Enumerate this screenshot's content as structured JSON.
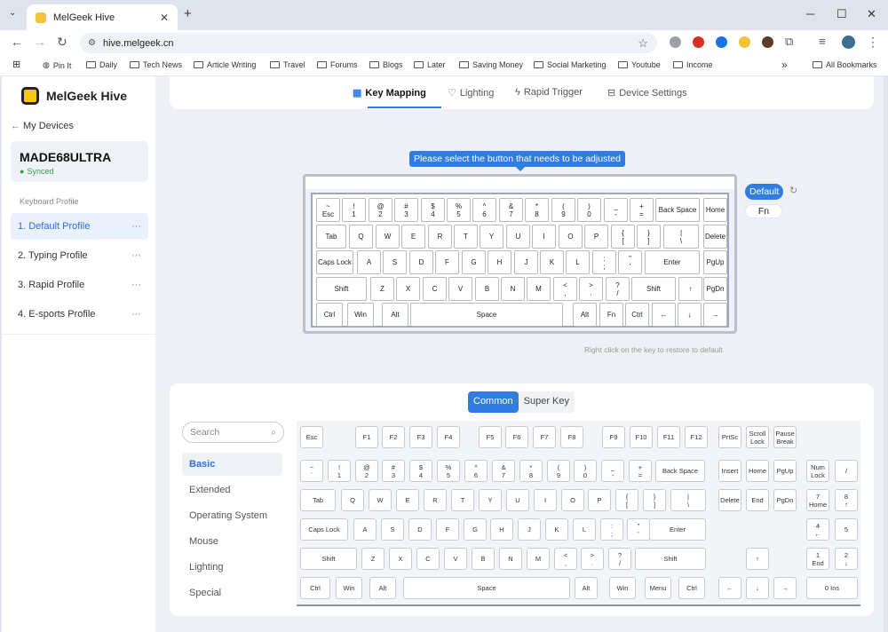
{
  "browser": {
    "tab_title": "MelGeek Hive",
    "url": "hive.melgeek.cn",
    "new_tab": "+",
    "tab_close": "✕",
    "win_min": "─",
    "win_max": "☐",
    "win_close": "✕",
    "bookmarks": [
      "Pin It",
      "Daily",
      "Tech News",
      "Article Writing",
      "Travel",
      "Forums",
      "Blogs",
      "Later",
      "Saving Money",
      "Social Marketing",
      "Youtube",
      "Income"
    ],
    "more_bookmarks": "»",
    "all_bookmarks": "All Bookmarks"
  },
  "sidebar": {
    "brand": "MelGeek Hive",
    "back_label": "My Devices",
    "device_name": "MADE68ULTRA",
    "device_status": "Synced",
    "section_label": "Keyboard Profile",
    "profiles": [
      {
        "label": "1. Default Profile",
        "active": true
      },
      {
        "label": "2. Typing Profile",
        "active": false
      },
      {
        "label": "3. Rapid Profile",
        "active": false
      },
      {
        "label": "4. E-sports Profile",
        "active": false
      }
    ],
    "more": "···"
  },
  "tabs": {
    "key_mapping": "Key Mapping",
    "lighting": "Lighting",
    "rapid_trigger": "Rapid Trigger",
    "device_settings": "Device Settings"
  },
  "mapping": {
    "tooltip": "Please select the button that needs to be adjusted",
    "layer_default": "Default",
    "layer_fn": "Fn",
    "hint": "Right click on the key to restore to default"
  },
  "keyboard_keys": [
    "~\nEsc",
    "!\n1",
    "@\n2",
    "#\n3",
    "$\n4",
    "%\n5",
    "^\n6",
    "&\n7",
    "*\n8",
    "(\n9",
    ")\n0",
    "_\n-",
    "+\n=",
    "Back Space",
    "Home",
    "Tab",
    "Q",
    "W",
    "E",
    "R",
    "T",
    "Y",
    "U",
    "I",
    "O",
    "P",
    "{\n[",
    "}\n]",
    "|\n\\",
    "Delete",
    "Caps Lock",
    "A",
    "S",
    "D",
    "F",
    "G",
    "H",
    "J",
    "K",
    "L",
    ":\n;",
    "\"\n'",
    "Enter",
    "PgUp",
    "Shift",
    "Z",
    "X",
    "C",
    "V",
    "B",
    "N",
    "M",
    "<\n,",
    ">\n.",
    "?\n/",
    "Shift",
    "↑",
    "PgDn",
    "Ctrl",
    "Win",
    "Alt",
    "Space",
    "Alt",
    "Fn",
    "Ctrl",
    "←",
    "↓",
    "→"
  ],
  "palette": {
    "seg_common": "Common",
    "seg_super": "Super Key",
    "search_placeholder": "Search",
    "categories": [
      "Basic",
      "Extended",
      "Operating System",
      "Mouse",
      "Lighting",
      "Special"
    ],
    "keys": [
      "Esc",
      "F1",
      "F2",
      "F3",
      "F4",
      "F5",
      "F6",
      "F7",
      "F8",
      "F9",
      "F10",
      "F11",
      "F12",
      "PrtSc",
      "Scroll\nLock",
      "Pause\nBreak",
      "~\n`",
      "!\n1",
      "@\n2",
      "#\n3",
      "$\n4",
      "%\n5",
      "^\n6",
      "&\n7",
      "*\n8",
      "(\n9",
      ")\n0",
      "_\n-",
      "+\n=",
      "Back Space",
      "Insert",
      "Home",
      "PgUp",
      "Num\nLock",
      "/",
      "Tab",
      "Q",
      "W",
      "E",
      "R",
      "T",
      "Y",
      "U",
      "I",
      "O",
      "P",
      "{\n[",
      "}\n]",
      "|\n\\",
      "Delete",
      "End",
      "PgDn",
      "7\nHome",
      "8\n↑",
      "Caps Lock",
      "A",
      "S",
      "D",
      "F",
      "G",
      "H",
      "J",
      "K",
      "L",
      ":\n;",
      "\"\n'",
      "Enter",
      "4\n←",
      "5",
      "Shift",
      "Z",
      "X",
      "C",
      "V",
      "B",
      "N",
      "M",
      "<\n,",
      ">\n.",
      "?\n/",
      "Shift",
      "↑",
      "1\nEnd",
      "2\n↓",
      "Ctrl",
      "Win",
      "Alt",
      "Space",
      "Alt",
      "Win",
      "Menu",
      "Ctrl",
      "←",
      "↓",
      "→",
      "0 Ins"
    ]
  }
}
